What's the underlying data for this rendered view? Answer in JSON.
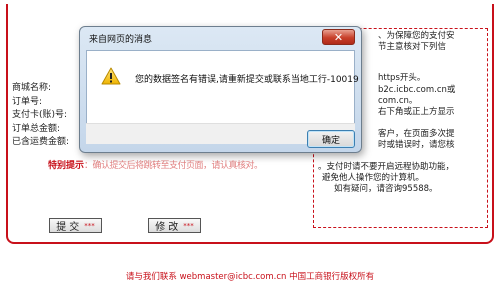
{
  "form": {
    "labels": [
      "商城名称:",
      "订单号:",
      "支付卡(账)号:",
      "订单总金额:",
      "已含运费金额:"
    ],
    "special_note": "特别提示",
    "special_note_rest": "：确认提交后将跳转至支付页面，请认真核对。"
  },
  "notice": {
    "lines": [
      "、为保障您的支付安",
      "节主意核对下列信",
      "https开头。",
      "b2c.icbc.com.cn或",
      "com.cn。",
      "右下角或正上方显示",
      "客户，在页面多次提",
      "时或错误时，请您核",
      "。支付时请不要开启远程协助功能，",
      "避免他人操作您的计算机。",
      "如有疑问，请咨询95588。"
    ]
  },
  "buttons": {
    "submit_label": "提交",
    "modify_label": "修改",
    "stars": "***"
  },
  "footer": {
    "prefix": "请与我们联系",
    "email": "webmaster@icbc.com.cn",
    "suffix": "中国工商银行版权所有"
  },
  "dialog": {
    "title": "来自网页的消息",
    "close_glyph": "✕",
    "message": "您的数据签名有错误,请重新提交或联系当地工行-10019",
    "ok_label": "确定",
    "icon": "warning-icon"
  },
  "colors": {
    "accent_red": "#c8101a"
  }
}
